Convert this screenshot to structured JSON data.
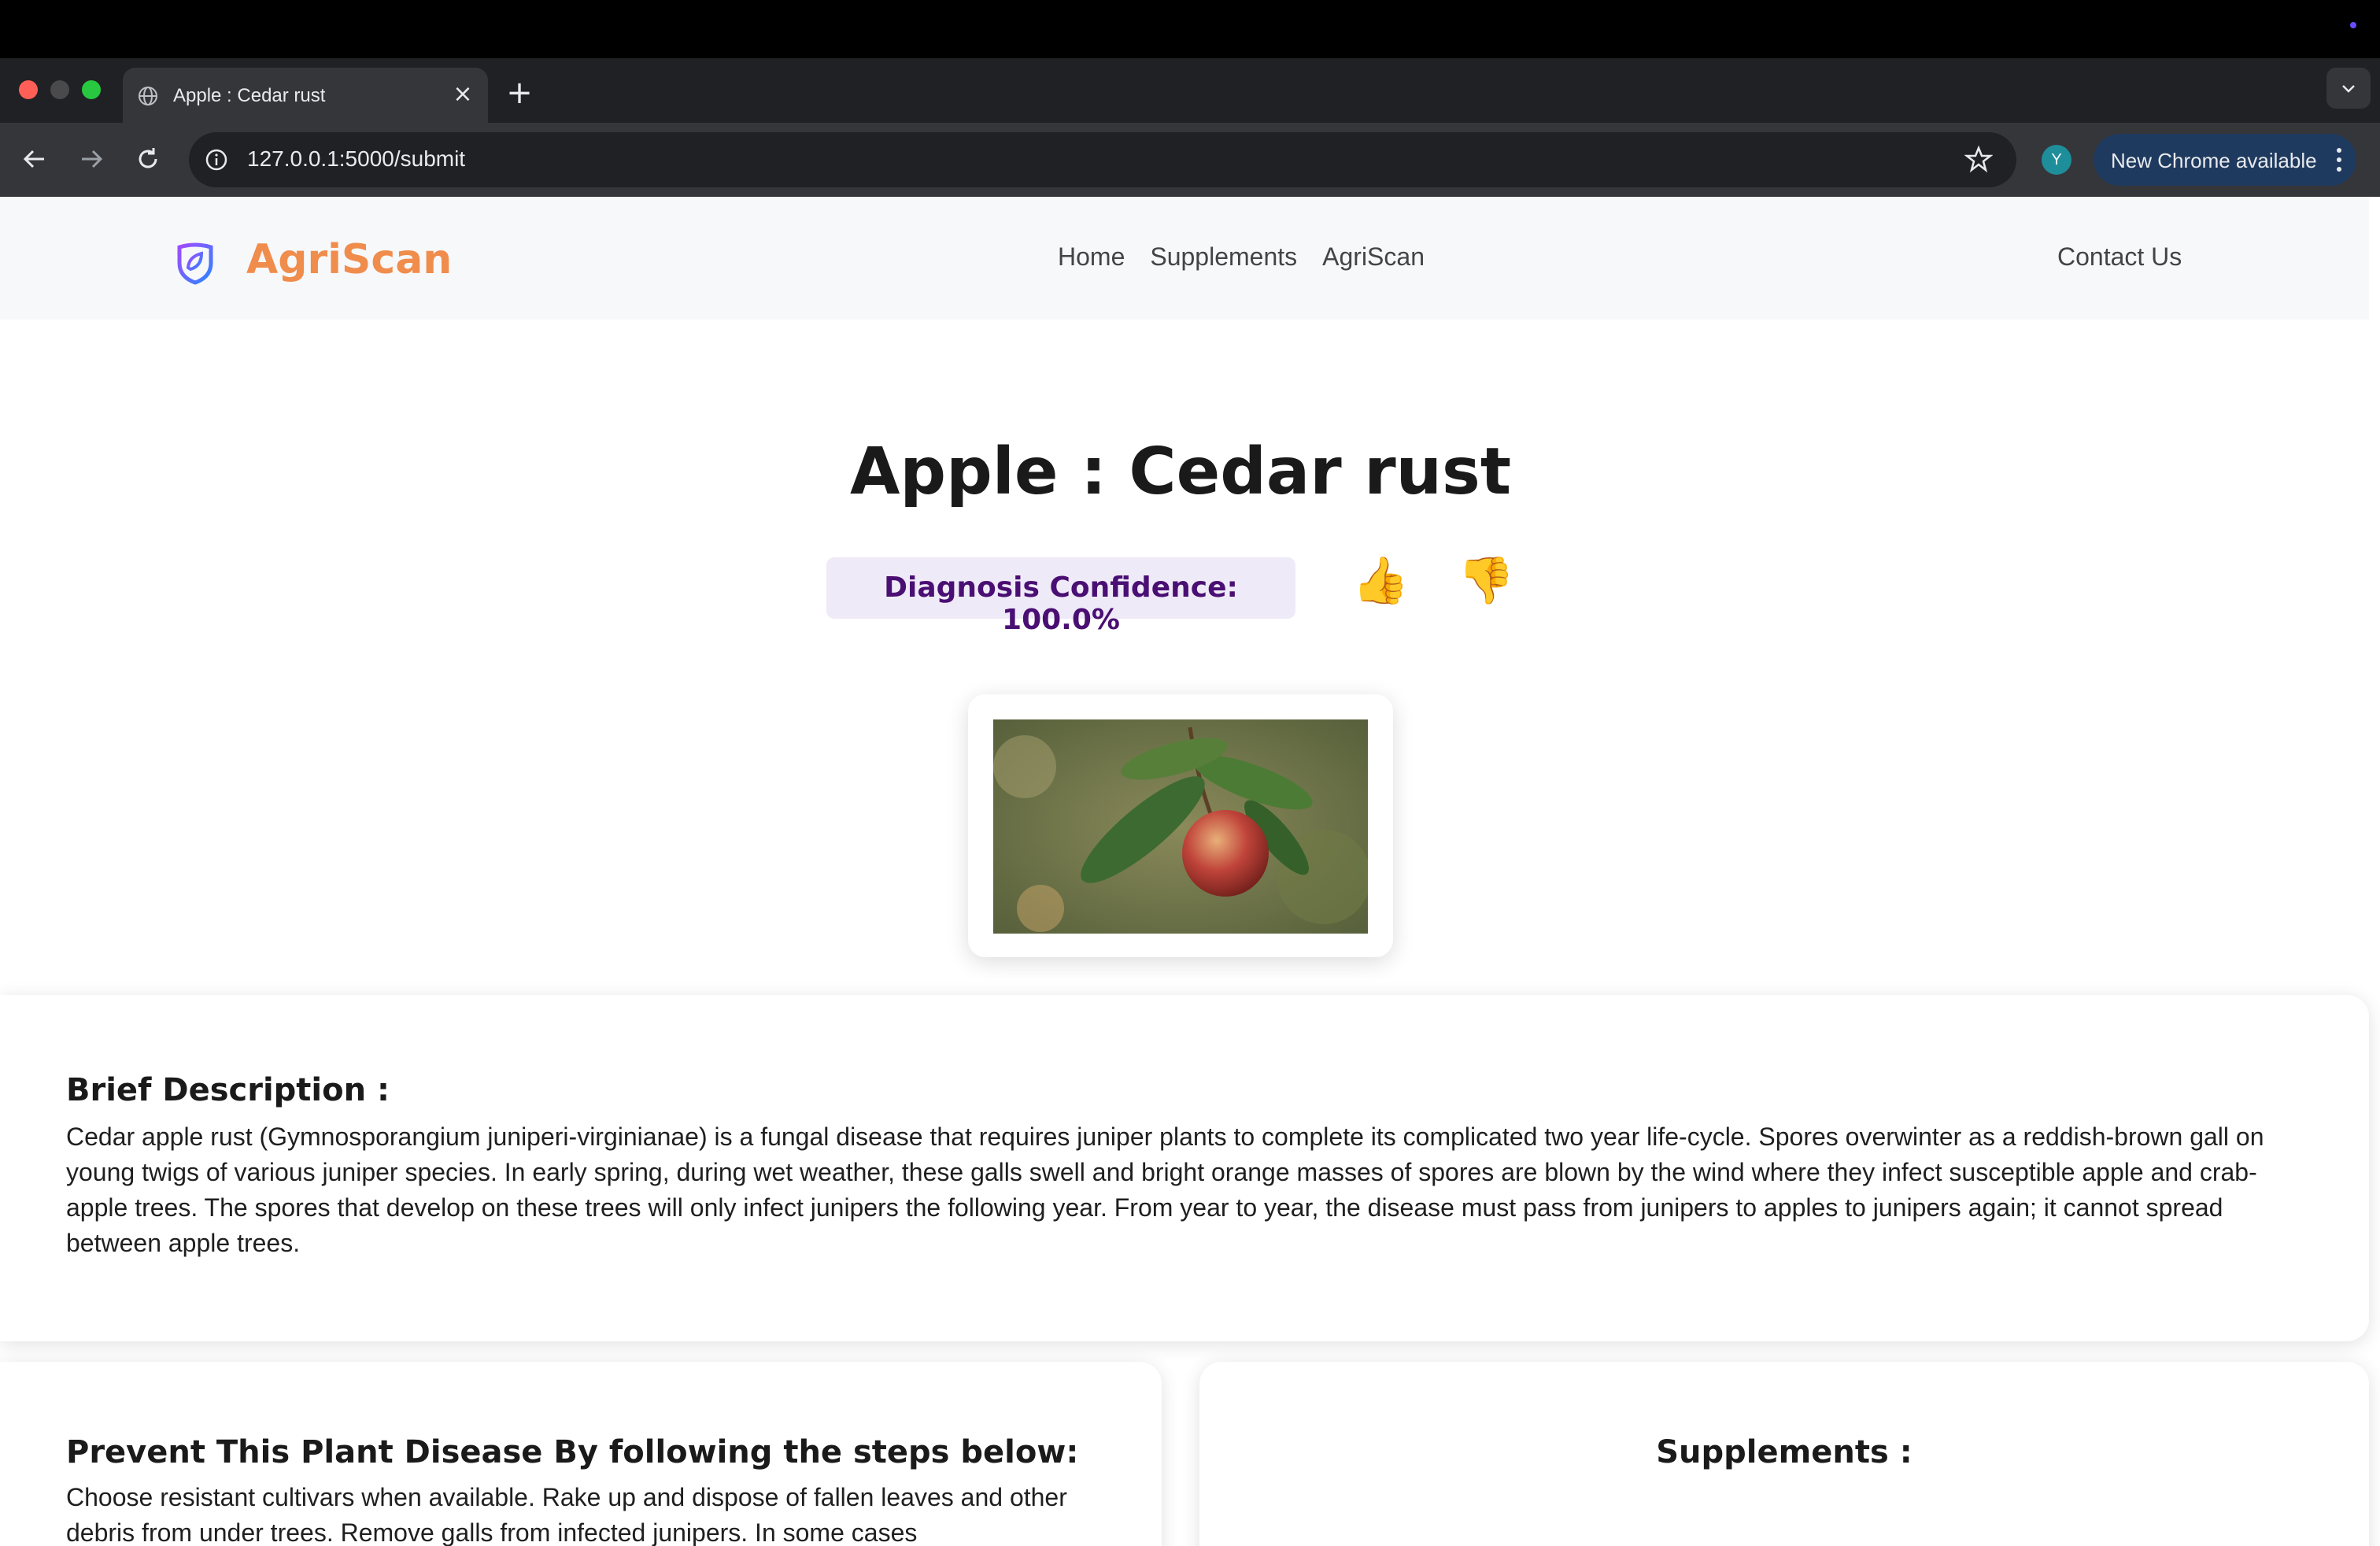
{
  "browser": {
    "tab_title": "Apple : Cedar rust",
    "new_tab_symbol": "+",
    "close_symbol": "×",
    "url": "127.0.0.1:5000/submit",
    "profile_initial": "Y",
    "update_label": "New Chrome available"
  },
  "site": {
    "brand_name": "AgriScan",
    "nav": {
      "home": "Home",
      "supplements": "Supplements",
      "agriscan": "AgriScan",
      "contact": "Contact Us"
    },
    "colors": {
      "brand": "#f08c4c",
      "confidence_bg": "#efeaf8",
      "confidence_text": "#4a0f73"
    }
  },
  "result": {
    "title": "Apple : Cedar rust",
    "confidence_label": "Diagnosis Confidence: 100.0%",
    "thumbs_up": "👍",
    "thumbs_down": "👎"
  },
  "description": {
    "heading": "Brief Description :",
    "text": "Cedar apple rust (Gymnosporangium juniperi-virginianae) is a fungal disease that requires juniper plants to complete its complicated two year life-cycle. Spores overwinter as a reddish-brown gall on young twigs of various juniper species. In early spring, during wet weather, these galls swell and bright orange masses of spores are blown by the wind where they infect susceptible apple and crab-apple trees. The spores that develop on these trees will only infect junipers the following year. From year to year, the disease must pass from junipers to apples to junipers again; it cannot spread between apple trees."
  },
  "prevention": {
    "heading": "Prevent This Plant Disease By following the steps below:",
    "text": "Choose resistant cultivars when available. Rake up and dispose of fallen leaves and other debris from under trees. Remove galls from infected junipers. In some cases"
  },
  "supplements": {
    "heading": "Supplements :"
  }
}
